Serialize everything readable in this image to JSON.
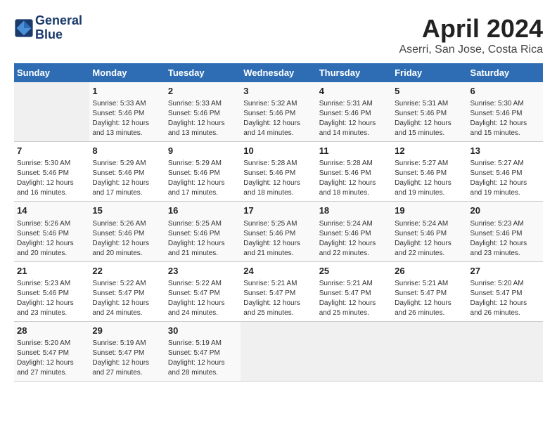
{
  "header": {
    "logo_line1": "General",
    "logo_line2": "Blue",
    "month_title": "April 2024",
    "subtitle": "Aserri, San Jose, Costa Rica"
  },
  "weekdays": [
    "Sunday",
    "Monday",
    "Tuesday",
    "Wednesday",
    "Thursday",
    "Friday",
    "Saturday"
  ],
  "weeks": [
    [
      {
        "day": "",
        "info": ""
      },
      {
        "day": "1",
        "info": "Sunrise: 5:33 AM\nSunset: 5:46 PM\nDaylight: 12 hours\nand 13 minutes."
      },
      {
        "day": "2",
        "info": "Sunrise: 5:33 AM\nSunset: 5:46 PM\nDaylight: 12 hours\nand 13 minutes."
      },
      {
        "day": "3",
        "info": "Sunrise: 5:32 AM\nSunset: 5:46 PM\nDaylight: 12 hours\nand 14 minutes."
      },
      {
        "day": "4",
        "info": "Sunrise: 5:31 AM\nSunset: 5:46 PM\nDaylight: 12 hours\nand 14 minutes."
      },
      {
        "day": "5",
        "info": "Sunrise: 5:31 AM\nSunset: 5:46 PM\nDaylight: 12 hours\nand 15 minutes."
      },
      {
        "day": "6",
        "info": "Sunrise: 5:30 AM\nSunset: 5:46 PM\nDaylight: 12 hours\nand 15 minutes."
      }
    ],
    [
      {
        "day": "7",
        "info": "Sunrise: 5:30 AM\nSunset: 5:46 PM\nDaylight: 12 hours\nand 16 minutes."
      },
      {
        "day": "8",
        "info": "Sunrise: 5:29 AM\nSunset: 5:46 PM\nDaylight: 12 hours\nand 17 minutes."
      },
      {
        "day": "9",
        "info": "Sunrise: 5:29 AM\nSunset: 5:46 PM\nDaylight: 12 hours\nand 17 minutes."
      },
      {
        "day": "10",
        "info": "Sunrise: 5:28 AM\nSunset: 5:46 PM\nDaylight: 12 hours\nand 18 minutes."
      },
      {
        "day": "11",
        "info": "Sunrise: 5:28 AM\nSunset: 5:46 PM\nDaylight: 12 hours\nand 18 minutes."
      },
      {
        "day": "12",
        "info": "Sunrise: 5:27 AM\nSunset: 5:46 PM\nDaylight: 12 hours\nand 19 minutes."
      },
      {
        "day": "13",
        "info": "Sunrise: 5:27 AM\nSunset: 5:46 PM\nDaylight: 12 hours\nand 19 minutes."
      }
    ],
    [
      {
        "day": "14",
        "info": "Sunrise: 5:26 AM\nSunset: 5:46 PM\nDaylight: 12 hours\nand 20 minutes."
      },
      {
        "day": "15",
        "info": "Sunrise: 5:26 AM\nSunset: 5:46 PM\nDaylight: 12 hours\nand 20 minutes."
      },
      {
        "day": "16",
        "info": "Sunrise: 5:25 AM\nSunset: 5:46 PM\nDaylight: 12 hours\nand 21 minutes."
      },
      {
        "day": "17",
        "info": "Sunrise: 5:25 AM\nSunset: 5:46 PM\nDaylight: 12 hours\nand 21 minutes."
      },
      {
        "day": "18",
        "info": "Sunrise: 5:24 AM\nSunset: 5:46 PM\nDaylight: 12 hours\nand 22 minutes."
      },
      {
        "day": "19",
        "info": "Sunrise: 5:24 AM\nSunset: 5:46 PM\nDaylight: 12 hours\nand 22 minutes."
      },
      {
        "day": "20",
        "info": "Sunrise: 5:23 AM\nSunset: 5:46 PM\nDaylight: 12 hours\nand 23 minutes."
      }
    ],
    [
      {
        "day": "21",
        "info": "Sunrise: 5:23 AM\nSunset: 5:46 PM\nDaylight: 12 hours\nand 23 minutes."
      },
      {
        "day": "22",
        "info": "Sunrise: 5:22 AM\nSunset: 5:47 PM\nDaylight: 12 hours\nand 24 minutes."
      },
      {
        "day": "23",
        "info": "Sunrise: 5:22 AM\nSunset: 5:47 PM\nDaylight: 12 hours\nand 24 minutes."
      },
      {
        "day": "24",
        "info": "Sunrise: 5:21 AM\nSunset: 5:47 PM\nDaylight: 12 hours\nand 25 minutes."
      },
      {
        "day": "25",
        "info": "Sunrise: 5:21 AM\nSunset: 5:47 PM\nDaylight: 12 hours\nand 25 minutes."
      },
      {
        "day": "26",
        "info": "Sunrise: 5:21 AM\nSunset: 5:47 PM\nDaylight: 12 hours\nand 26 minutes."
      },
      {
        "day": "27",
        "info": "Sunrise: 5:20 AM\nSunset: 5:47 PM\nDaylight: 12 hours\nand 26 minutes."
      }
    ],
    [
      {
        "day": "28",
        "info": "Sunrise: 5:20 AM\nSunset: 5:47 PM\nDaylight: 12 hours\nand 27 minutes."
      },
      {
        "day": "29",
        "info": "Sunrise: 5:19 AM\nSunset: 5:47 PM\nDaylight: 12 hours\nand 27 minutes."
      },
      {
        "day": "30",
        "info": "Sunrise: 5:19 AM\nSunset: 5:47 PM\nDaylight: 12 hours\nand 28 minutes."
      },
      {
        "day": "",
        "info": ""
      },
      {
        "day": "",
        "info": ""
      },
      {
        "day": "",
        "info": ""
      },
      {
        "day": "",
        "info": ""
      }
    ]
  ]
}
